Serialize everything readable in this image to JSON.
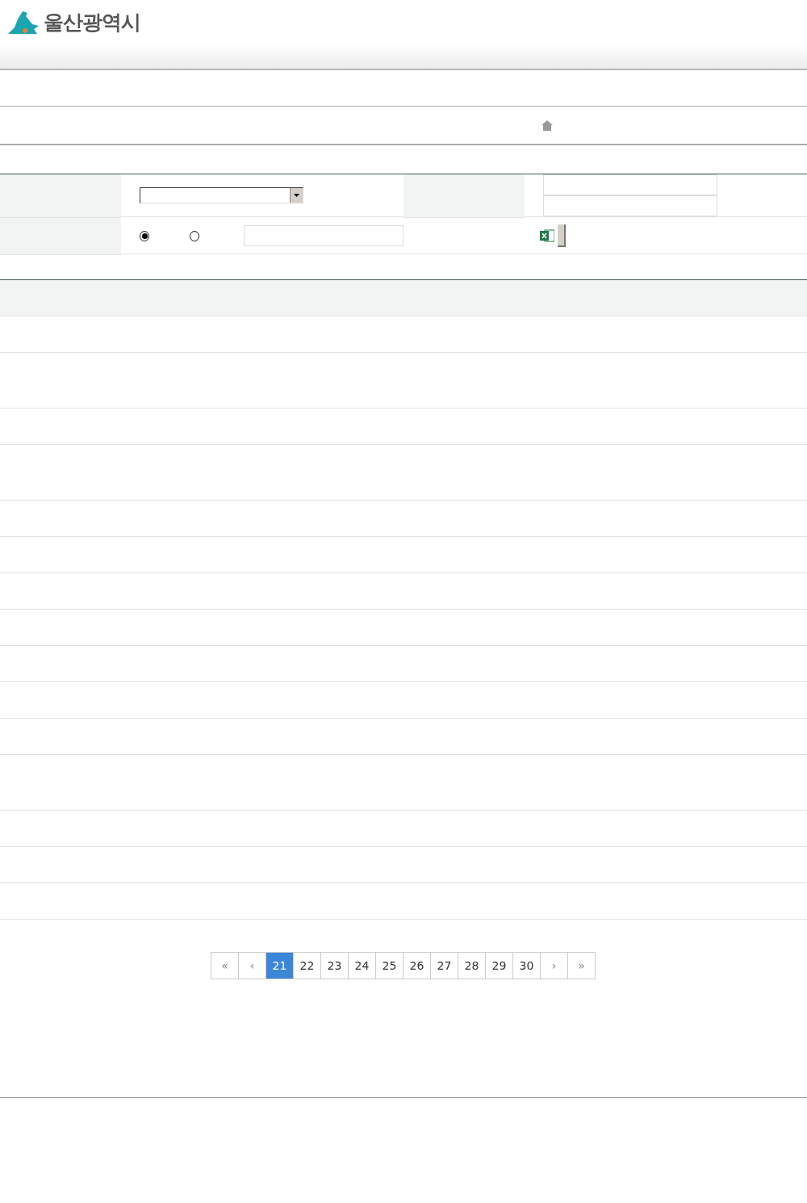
{
  "header": {
    "logo_text": "울산광역시"
  },
  "search": {
    "radios": [
      {
        "selected": true
      },
      {
        "selected": false
      }
    ]
  },
  "pagination": {
    "first": "«",
    "prev": "‹",
    "pages": [
      {
        "label": "21",
        "selected": true
      },
      {
        "label": "22",
        "selected": false
      },
      {
        "label": "23",
        "selected": false
      },
      {
        "label": "24",
        "selected": false
      },
      {
        "label": "25",
        "selected": false
      },
      {
        "label": "26",
        "selected": false
      },
      {
        "label": "27",
        "selected": false
      },
      {
        "label": "28",
        "selected": false
      },
      {
        "label": "29",
        "selected": false
      },
      {
        "label": "30",
        "selected": false
      }
    ],
    "next": "›",
    "last": "»"
  }
}
